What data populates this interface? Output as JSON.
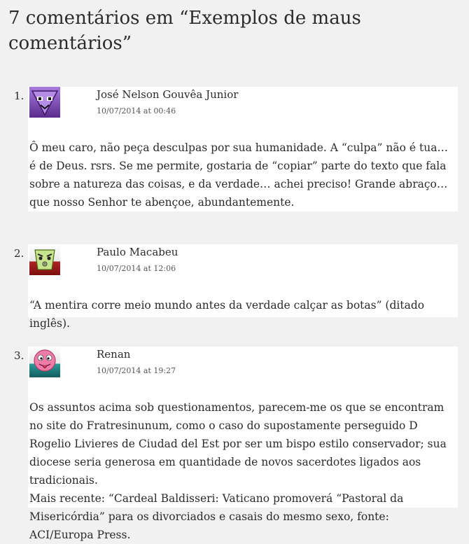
{
  "comments_section": {
    "title": "7 comentários em “Exemplos de maus comentários”"
  },
  "comments": [
    {
      "number": "1.",
      "author": "José Nelson Gouvêa Junior",
      "date": "10/07/2014 at 00:46",
      "avatar_icon": "purple-triangle-face-avatar-icon",
      "avatar_colors": [
        "#8a58c9",
        "#5b2c8c"
      ],
      "paragraphs": [
        "Ô meu caro, não peça desculpas por sua humanidade. A “culpa” não é tua… é de Deus. rsrs. Se me permite, gostaria de “copiar” parte do texto que fala sobre a natureza das coisas, e da verdade… achei preciso! Grande abraço… que nosso Senhor te abençoe, abundantemente."
      ]
    },
    {
      "number": "2.",
      "author": "Paulo Macabeu",
      "date": "10/07/2014 at 12:06",
      "avatar_icon": "green-angry-face-avatar-icon",
      "avatar_colors": [
        "#c7e38c",
        "#8b1a1a"
      ],
      "paragraphs": [
        "“A mentira corre meio mundo antes da verdade calçar as botas” (ditado inglês)."
      ]
    },
    {
      "number": "3.",
      "author": "Renan",
      "date": "10/07/2014 at 19:27",
      "avatar_icon": "pink-tongue-face-avatar-icon",
      "avatar_colors": [
        "#f07ca8",
        "#1f7f7f"
      ],
      "paragraphs": [
        "Os assuntos acima sob questionamentos, parecem-me os que se encontram no site do Fratresinunum, como o caso do supostamente perseguido D Rogelio Livieres de Ciudad del Est por ser um bispo estilo conservador; sua diocese seria generosa em quantidade de novos sacerdotes ligados aos tradicionais.",
        "Mais recente: “Cardeal Baldisseri: Vaticano promoverá “Pastoral da Misericórdia” para os divorciados e casais do mesmo sexo, fonte: ACI/Europa Press."
      ]
    }
  ]
}
